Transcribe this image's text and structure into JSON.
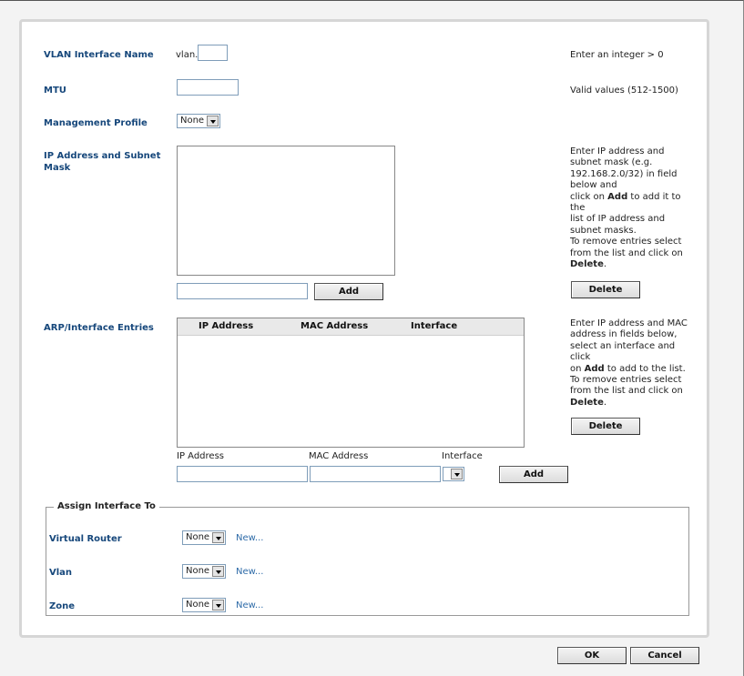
{
  "form": {
    "vlan_name": {
      "label": "VLAN Interface Name",
      "prefix": "vlan.",
      "value": "",
      "hint": "Enter an integer > 0"
    },
    "mtu": {
      "label": "MTU",
      "value": "",
      "hint": "Valid values (512-1500)"
    },
    "management_profile": {
      "label": "Management Profile",
      "selected": "None"
    },
    "ip_subnet": {
      "label": "IP Address and Subnet Mask",
      "entry_value": "",
      "add_label": "Add",
      "delete_label": "Delete",
      "hint": {
        "line1": "Enter IP address and",
        "line2": "subnet mask (e.g.",
        "line3": "192.168.2.0/32) in field",
        "line4": "below and",
        "line5_pre": "click on ",
        "line5_bold": "Add",
        "line5_post": " to add it to the",
        "line6": "list of IP address and",
        "line7": "subnet masks.",
        "line8": "To remove entries select",
        "line9": "from the list and click on",
        "line10_bold": "Delete",
        "line10_post": "."
      }
    },
    "arp": {
      "label": "ARP/Interface Entries",
      "columns": [
        "IP Address",
        "MAC Address",
        "Interface"
      ],
      "rows": [],
      "ip_label": "IP Address",
      "mac_label": "MAC Address",
      "interface_label": "Interface",
      "ip_value": "",
      "mac_value": "",
      "interface_selected": "",
      "add_label": "Add",
      "delete_label": "Delete",
      "hint": {
        "line1": "Enter IP address and MAC",
        "line2": "address in fields below,",
        "line3": "select an interface and click",
        "line4_pre": "on ",
        "line4_bold": "Add",
        "line4_post": " to add to the list.",
        "line5": "To remove entries select",
        "line6": "from the list and click on",
        "line7_bold": "Delete",
        "line7_post": "."
      }
    }
  },
  "assign": {
    "legend": "Assign Interface To",
    "virtual_router": {
      "label": "Virtual Router",
      "selected": "None",
      "new_label": "New..."
    },
    "vlan": {
      "label": "Vlan",
      "selected": "None",
      "new_label": "New..."
    },
    "zone": {
      "label": "Zone",
      "selected": "None",
      "new_label": "New..."
    }
  },
  "footer": {
    "ok_label": "OK",
    "cancel_label": "Cancel"
  },
  "colors": {
    "label_blue": "#16477b",
    "link_blue": "#2e6ba8",
    "panel_border": "#d6d6d6"
  }
}
